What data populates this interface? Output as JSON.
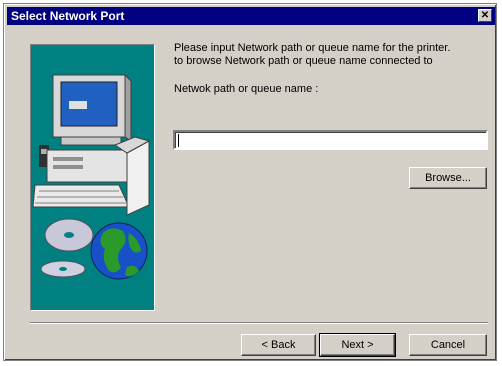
{
  "window": {
    "title": "Select Network Port",
    "close_glyph": "✕"
  },
  "instructions": {
    "line1": "Please input Network path or queue name for the printer.",
    "line2": "to browse Network path or queue name connected to"
  },
  "field": {
    "label": "Netwok path or queue name :",
    "value": ""
  },
  "buttons": {
    "browse": "Browse...",
    "back": "< Back",
    "next": "Next >",
    "cancel": "Cancel"
  },
  "colors": {
    "title_bar": "#000080",
    "face": "#d4d0c8",
    "side_panel": "#008080"
  },
  "icons": [
    "computer-icon",
    "cd-disc-icon",
    "globe-icon"
  ]
}
